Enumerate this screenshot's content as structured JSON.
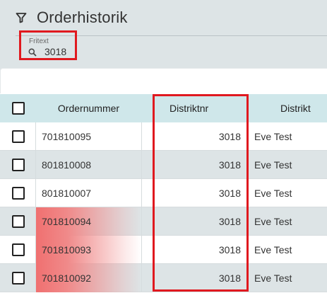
{
  "header": {
    "title": "Orderhistorik",
    "icon": "filter-icon"
  },
  "search": {
    "label": "Fritext",
    "value": "3018",
    "icon": "search-icon"
  },
  "table": {
    "columns": [
      "Ordernummer",
      "Distriktnr",
      "Distrikt"
    ],
    "rows": [
      {
        "order": "701810095",
        "distriktnr": "3018",
        "distrikt": "Eve Test"
      },
      {
        "order": "801810008",
        "distriktnr": "3018",
        "distrikt": "Eve Test"
      },
      {
        "order": "801810007",
        "distriktnr": "3018",
        "distrikt": "Eve Test"
      },
      {
        "order": "701810094",
        "distriktnr": "3018",
        "distrikt": "Eve Test"
      },
      {
        "order": "701810093",
        "distriktnr": "3018",
        "distrikt": "Eve Test"
      },
      {
        "order": "701810092",
        "distriktnr": "3018",
        "distrikt": "Eve Test"
      }
    ]
  },
  "colors": {
    "header_bg": "#dde4e6",
    "table_header_bg": "#cfe7ea",
    "annotation_red": "#e0191f",
    "row_highlight": "#f07070"
  }
}
